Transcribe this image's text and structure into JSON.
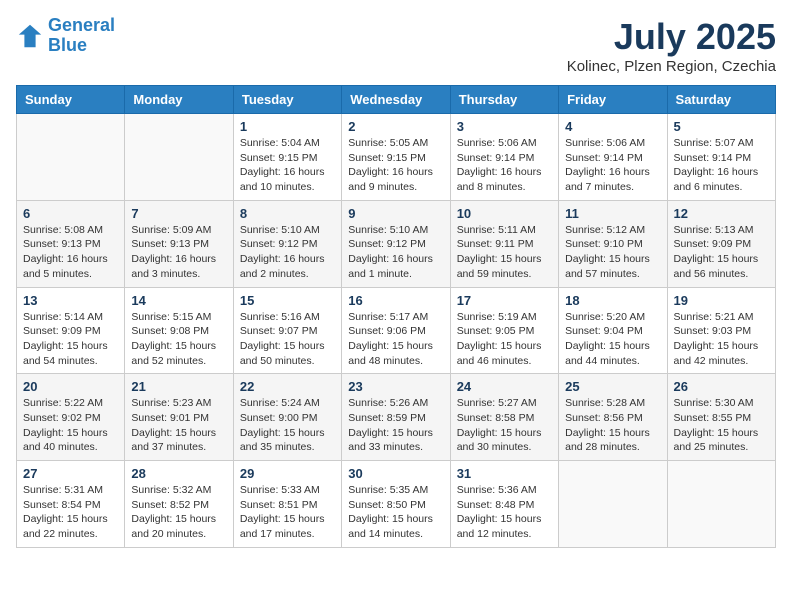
{
  "header": {
    "logo_line1": "General",
    "logo_line2": "Blue",
    "month": "July 2025",
    "location": "Kolinec, Plzen Region, Czechia"
  },
  "weekdays": [
    "Sunday",
    "Monday",
    "Tuesday",
    "Wednesday",
    "Thursday",
    "Friday",
    "Saturday"
  ],
  "weeks": [
    [
      {
        "day": "",
        "info": ""
      },
      {
        "day": "",
        "info": ""
      },
      {
        "day": "1",
        "info": "Sunrise: 5:04 AM\nSunset: 9:15 PM\nDaylight: 16 hours\nand 10 minutes."
      },
      {
        "day": "2",
        "info": "Sunrise: 5:05 AM\nSunset: 9:15 PM\nDaylight: 16 hours\nand 9 minutes."
      },
      {
        "day": "3",
        "info": "Sunrise: 5:06 AM\nSunset: 9:14 PM\nDaylight: 16 hours\nand 8 minutes."
      },
      {
        "day": "4",
        "info": "Sunrise: 5:06 AM\nSunset: 9:14 PM\nDaylight: 16 hours\nand 7 minutes."
      },
      {
        "day": "5",
        "info": "Sunrise: 5:07 AM\nSunset: 9:14 PM\nDaylight: 16 hours\nand 6 minutes."
      }
    ],
    [
      {
        "day": "6",
        "info": "Sunrise: 5:08 AM\nSunset: 9:13 PM\nDaylight: 16 hours\nand 5 minutes."
      },
      {
        "day": "7",
        "info": "Sunrise: 5:09 AM\nSunset: 9:13 PM\nDaylight: 16 hours\nand 3 minutes."
      },
      {
        "day": "8",
        "info": "Sunrise: 5:10 AM\nSunset: 9:12 PM\nDaylight: 16 hours\nand 2 minutes."
      },
      {
        "day": "9",
        "info": "Sunrise: 5:10 AM\nSunset: 9:12 PM\nDaylight: 16 hours\nand 1 minute."
      },
      {
        "day": "10",
        "info": "Sunrise: 5:11 AM\nSunset: 9:11 PM\nDaylight: 15 hours\nand 59 minutes."
      },
      {
        "day": "11",
        "info": "Sunrise: 5:12 AM\nSunset: 9:10 PM\nDaylight: 15 hours\nand 57 minutes."
      },
      {
        "day": "12",
        "info": "Sunrise: 5:13 AM\nSunset: 9:09 PM\nDaylight: 15 hours\nand 56 minutes."
      }
    ],
    [
      {
        "day": "13",
        "info": "Sunrise: 5:14 AM\nSunset: 9:09 PM\nDaylight: 15 hours\nand 54 minutes."
      },
      {
        "day": "14",
        "info": "Sunrise: 5:15 AM\nSunset: 9:08 PM\nDaylight: 15 hours\nand 52 minutes."
      },
      {
        "day": "15",
        "info": "Sunrise: 5:16 AM\nSunset: 9:07 PM\nDaylight: 15 hours\nand 50 minutes."
      },
      {
        "day": "16",
        "info": "Sunrise: 5:17 AM\nSunset: 9:06 PM\nDaylight: 15 hours\nand 48 minutes."
      },
      {
        "day": "17",
        "info": "Sunrise: 5:19 AM\nSunset: 9:05 PM\nDaylight: 15 hours\nand 46 minutes."
      },
      {
        "day": "18",
        "info": "Sunrise: 5:20 AM\nSunset: 9:04 PM\nDaylight: 15 hours\nand 44 minutes."
      },
      {
        "day": "19",
        "info": "Sunrise: 5:21 AM\nSunset: 9:03 PM\nDaylight: 15 hours\nand 42 minutes."
      }
    ],
    [
      {
        "day": "20",
        "info": "Sunrise: 5:22 AM\nSunset: 9:02 PM\nDaylight: 15 hours\nand 40 minutes."
      },
      {
        "day": "21",
        "info": "Sunrise: 5:23 AM\nSunset: 9:01 PM\nDaylight: 15 hours\nand 37 minutes."
      },
      {
        "day": "22",
        "info": "Sunrise: 5:24 AM\nSunset: 9:00 PM\nDaylight: 15 hours\nand 35 minutes."
      },
      {
        "day": "23",
        "info": "Sunrise: 5:26 AM\nSunset: 8:59 PM\nDaylight: 15 hours\nand 33 minutes."
      },
      {
        "day": "24",
        "info": "Sunrise: 5:27 AM\nSunset: 8:58 PM\nDaylight: 15 hours\nand 30 minutes."
      },
      {
        "day": "25",
        "info": "Sunrise: 5:28 AM\nSunset: 8:56 PM\nDaylight: 15 hours\nand 28 minutes."
      },
      {
        "day": "26",
        "info": "Sunrise: 5:30 AM\nSunset: 8:55 PM\nDaylight: 15 hours\nand 25 minutes."
      }
    ],
    [
      {
        "day": "27",
        "info": "Sunrise: 5:31 AM\nSunset: 8:54 PM\nDaylight: 15 hours\nand 22 minutes."
      },
      {
        "day": "28",
        "info": "Sunrise: 5:32 AM\nSunset: 8:52 PM\nDaylight: 15 hours\nand 20 minutes."
      },
      {
        "day": "29",
        "info": "Sunrise: 5:33 AM\nSunset: 8:51 PM\nDaylight: 15 hours\nand 17 minutes."
      },
      {
        "day": "30",
        "info": "Sunrise: 5:35 AM\nSunset: 8:50 PM\nDaylight: 15 hours\nand 14 minutes."
      },
      {
        "day": "31",
        "info": "Sunrise: 5:36 AM\nSunset: 8:48 PM\nDaylight: 15 hours\nand 12 minutes."
      },
      {
        "day": "",
        "info": ""
      },
      {
        "day": "",
        "info": ""
      }
    ]
  ]
}
